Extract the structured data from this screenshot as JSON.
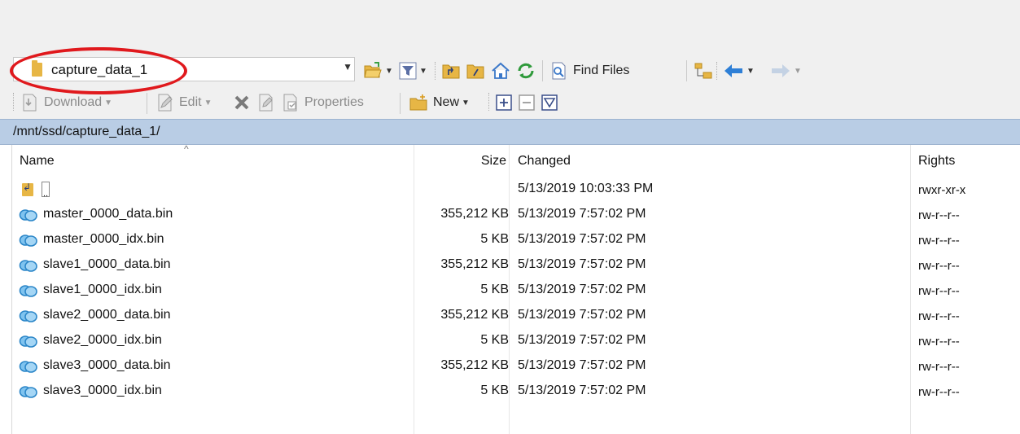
{
  "toolbar1": {
    "current_dir": "capture_data_1",
    "find_files_label": "Find Files",
    "icons": [
      "folder-icon",
      "open-folder-icon",
      "filter-icon",
      "parent-dir-icon",
      "root-dir-icon",
      "home-icon",
      "refresh-icon",
      "find-files-icon",
      "tree-icon",
      "back-icon",
      "forward-icon"
    ]
  },
  "toolbar2": {
    "download_label": "Download",
    "edit_label": "Edit",
    "properties_label": "Properties",
    "new_label": "New"
  },
  "path": "/mnt/ssd/capture_data_1/",
  "columns": {
    "name": "Name",
    "size": "Size",
    "changed": "Changed",
    "rights": "Rights"
  },
  "files": [
    {
      "name": "..",
      "size": "",
      "changed": "5/13/2019 10:03:33 PM",
      "rights": "rwxr-xr-x",
      "icon": "parent-dir-icon"
    },
    {
      "name": "master_0000_data.bin",
      "size": "355,212 KB",
      "changed": "5/13/2019 7:57:02 PM",
      "rights": "rw-r--r--",
      "icon": "bin-file-icon"
    },
    {
      "name": "master_0000_idx.bin",
      "size": "5 KB",
      "changed": "5/13/2019 7:57:02 PM",
      "rights": "rw-r--r--",
      "icon": "bin-file-icon"
    },
    {
      "name": "slave1_0000_data.bin",
      "size": "355,212 KB",
      "changed": "5/13/2019 7:57:02 PM",
      "rights": "rw-r--r--",
      "icon": "bin-file-icon"
    },
    {
      "name": "slave1_0000_idx.bin",
      "size": "5 KB",
      "changed": "5/13/2019 7:57:02 PM",
      "rights": "rw-r--r--",
      "icon": "bin-file-icon"
    },
    {
      "name": "slave2_0000_data.bin",
      "size": "355,212 KB",
      "changed": "5/13/2019 7:57:02 PM",
      "rights": "rw-r--r--",
      "icon": "bin-file-icon"
    },
    {
      "name": "slave2_0000_idx.bin",
      "size": "5 KB",
      "changed": "5/13/2019 7:57:02 PM",
      "rights": "rw-r--r--",
      "icon": "bin-file-icon"
    },
    {
      "name": "slave3_0000_data.bin",
      "size": "355,212 KB",
      "changed": "5/13/2019 7:57:02 PM",
      "rights": "rw-r--r--",
      "icon": "bin-file-icon"
    },
    {
      "name": "slave3_0000_idx.bin",
      "size": "5 KB",
      "changed": "5/13/2019 7:57:02 PM",
      "rights": "rw-r--r--",
      "icon": "bin-file-icon"
    }
  ],
  "colors": {
    "path_bar": "#b9cde5",
    "highlight_circle": "#e0191d",
    "folder": "#e7b645",
    "file_icon": "#4aa3df"
  }
}
